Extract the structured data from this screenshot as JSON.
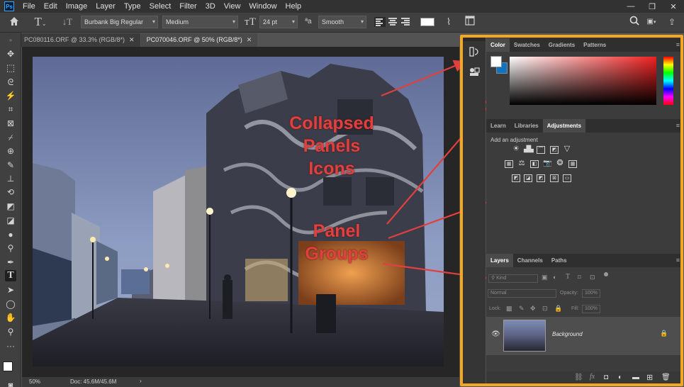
{
  "menubar": {
    "logo": "Ps",
    "items": [
      "File",
      "Edit",
      "Image",
      "Layer",
      "Type",
      "Select",
      "Filter",
      "3D",
      "View",
      "Window",
      "Help"
    ],
    "window_controls": [
      "—",
      "❐",
      "✕"
    ]
  },
  "options": {
    "font_family": "Burbank Big Regular",
    "font_style": "Medium",
    "font_size": "24 pt",
    "antialias": "Smooth",
    "aa_glyph": "ªa",
    "text_color": "#ffffff"
  },
  "tabs": [
    {
      "label": "PC080116.ORF @ 33.3% (RGB/8*)",
      "active": false
    },
    {
      "label": "PC070046.ORF @ 50% (RGB/8*)",
      "active": true
    }
  ],
  "tools": [
    "move-tool",
    "marquee-tool",
    "lasso-tool",
    "magic-wand-tool",
    "crop-tool",
    "frame-tool",
    "eyedropper-tool",
    "healing-tool",
    "brush-tool",
    "stamp-tool",
    "history-brush-tool",
    "eraser-tool",
    "gradient-tool",
    "blur-tool",
    "dodge-tool",
    "pen-tool",
    "type-tool",
    "path-select-tool",
    "ellipse-tool",
    "hand-tool",
    "zoom-tool",
    "more-tools"
  ],
  "status": {
    "zoom": "50%",
    "doc": "Doc: 45.6M/45.6M"
  },
  "color_panel": {
    "tabs": [
      "Color",
      "Swatches",
      "Gradients",
      "Patterns"
    ],
    "active": "Color"
  },
  "adjust_panel": {
    "tabs": [
      "Learn",
      "Libraries",
      "Adjustments"
    ],
    "active": "Adjustments",
    "heading": "Add an adjustment"
  },
  "layers_panel": {
    "tabs": [
      "Layers",
      "Channels",
      "Paths"
    ],
    "active": "Layers",
    "kind": "Kind",
    "blend": "Normal",
    "opacity_label": "Opacity:",
    "opacity_value": "100%",
    "lock_label": "Lock:",
    "fill_label": "Fill:",
    "fill_value": "100%",
    "layer_name": "Background"
  },
  "annotations": {
    "collapsed": "Collapsed Panels Icons",
    "groups": "Panel Groups"
  },
  "colors": {
    "accent": "#f5a623",
    "annotation": "#e0403e",
    "ps_blue": "#31a8ff"
  }
}
